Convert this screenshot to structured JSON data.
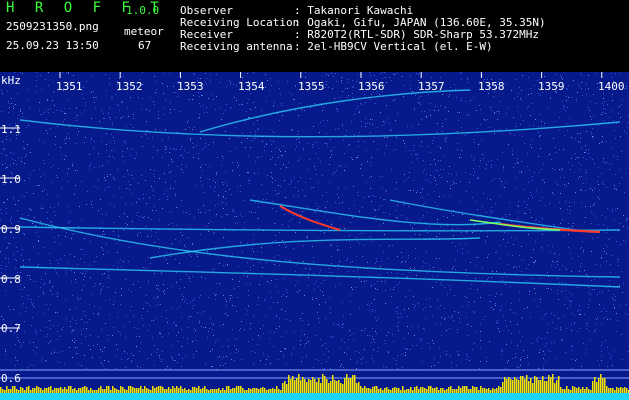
{
  "header": {
    "brand": "H R O F F T",
    "version": "1.0.0",
    "filename": "2509231350.png",
    "datetime": "25.09.23 13:50",
    "meteor_label": "meteor",
    "meteor_count": "67",
    "info": [
      {
        "key": "Observer",
        "value": ": Takanori Kawachi"
      },
      {
        "key": "Receiving Location",
        "value": ": Ogaki, Gifu, JAPAN (136.60E, 35.35N)"
      },
      {
        "key": "Receiver",
        "value": ": R820T2(RTL-SDR) SDR-Sharp 53.372MHz"
      },
      {
        "key": "Receiving antenna",
        "value": ": 2el-HB9CV Vertical (el. E-W)"
      }
    ]
  },
  "spectrogram": {
    "y_unit": "kHz",
    "time_ticks": [
      "1351",
      "1352",
      "1353",
      "1354",
      "1355",
      "1356",
      "1357",
      "1358",
      "1359",
      "1400"
    ],
    "freq_ticks": [
      "1.1",
      "1.0",
      "0.9",
      "0.8",
      "0.7",
      "0.6"
    ],
    "colors": {
      "background": "#061a8c",
      "trace": "#2fd6ff",
      "hot": "#ff3b2b",
      "bar": "#f5e400",
      "floor": "#18d6ff"
    }
  }
}
